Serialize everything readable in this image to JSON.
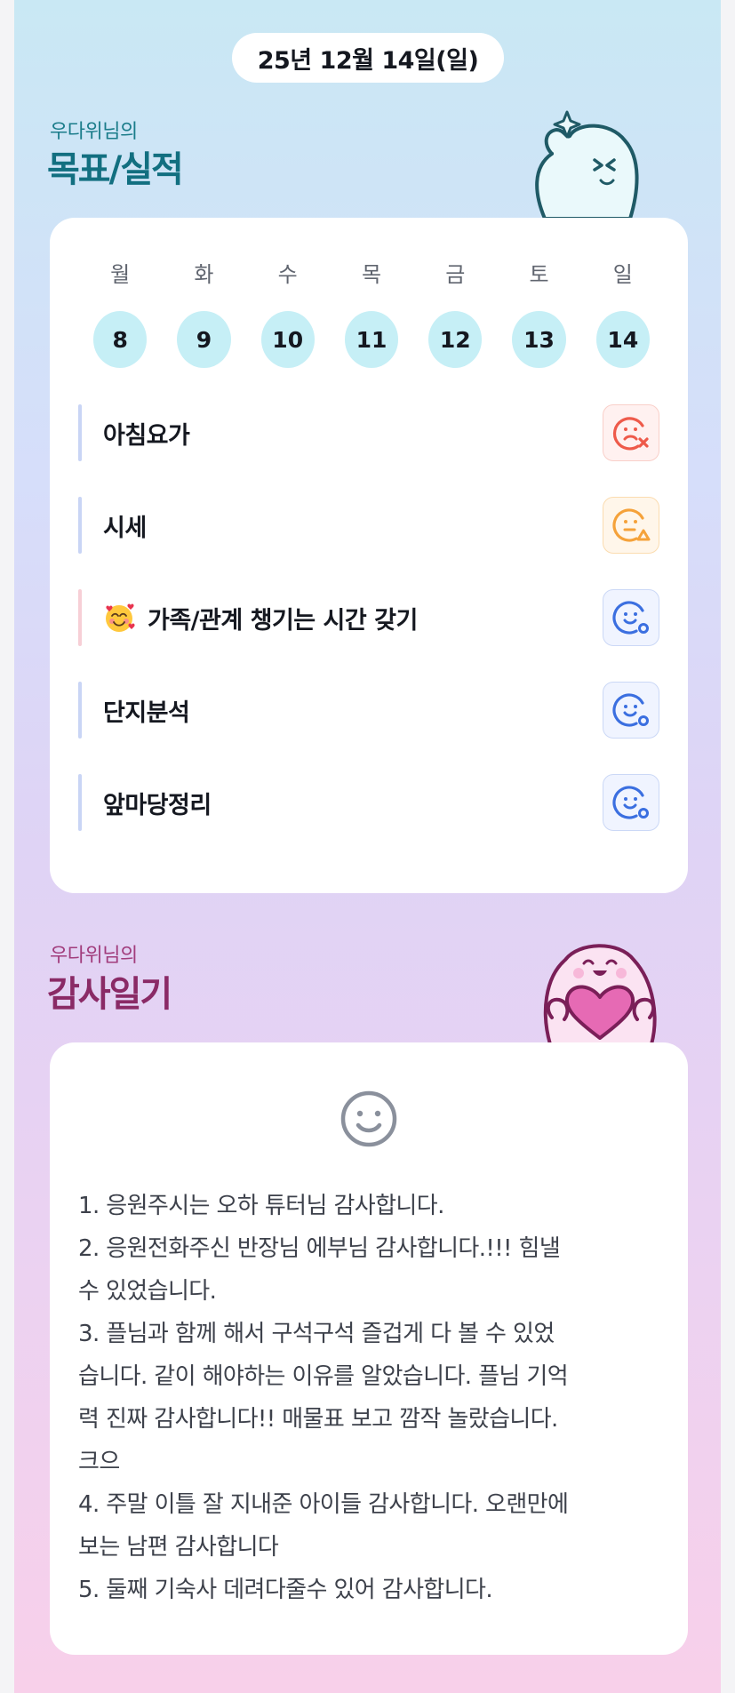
{
  "date": "25년 12월 14일(일)",
  "goals_section": {
    "subtitle": "우다위님의",
    "title": "목표/실적"
  },
  "week": {
    "days": [
      "월",
      "화",
      "수",
      "목",
      "금",
      "토",
      "일"
    ],
    "dates": [
      "8",
      "9",
      "10",
      "11",
      "12",
      "13",
      "14"
    ]
  },
  "goals": [
    {
      "label": "아침요가",
      "status": "failed",
      "icon": "sad-x-face-icon",
      "accent": "#c9d5f5"
    },
    {
      "label": "시세",
      "status": "partial",
      "icon": "meh-triangle-face-icon",
      "accent": "#c9d5f5"
    },
    {
      "label": "가족/관계 챙기는 시간 갖기",
      "status": "done",
      "icon": "smile-circle-face-icon",
      "accent": "#f7cfd6",
      "emoji": "smiling-face-with-hearts-icon"
    },
    {
      "label": "단지분석",
      "status": "done",
      "icon": "smile-circle-face-icon",
      "accent": "#c9d5f5"
    },
    {
      "label": "앞마당정리",
      "status": "done",
      "icon": "smile-circle-face-icon",
      "accent": "#c9d5f5"
    }
  ],
  "status_colors": {
    "failed": {
      "fg": "#ee5a4a",
      "bg": "#fff1f0",
      "border": "#f9cfc9"
    },
    "partial": {
      "fg": "#f5a23a",
      "bg": "#fff6ea",
      "border": "#fbdcb0"
    },
    "done": {
      "fg": "#3b6fe0",
      "bg": "#f0f4ff",
      "border": "#cbd8f6"
    }
  },
  "gratitude_section": {
    "subtitle": "우다위님의",
    "title": "감사일기"
  },
  "gratitude": {
    "icon": "smile-face-icon",
    "lines": [
      "1. 응원주시는 오하 튜터님 감사합니다.",
      "2. 응원전화주신 반장님 에부님 감사합니다.!!! 힘낼",
      "수 있었습니다.",
      "3. 플님과 함께 해서 구석구석 즐겁게  다 볼 수 있었",
      "습니다. 같이 해야하는 이유를 알았습니다. 플님 기억",
      "력 진짜 감사합니다!! 매물표 보고 깜작 놀랐습니다.",
      "크으",
      "4. 주말 이틀 잘 지내준 아이들 감사합니다. 오랜만에",
      "보는 남편 감사합니다",
      "5. 둘째 기숙사 데려다줄수 있어 감사합니다."
    ]
  }
}
